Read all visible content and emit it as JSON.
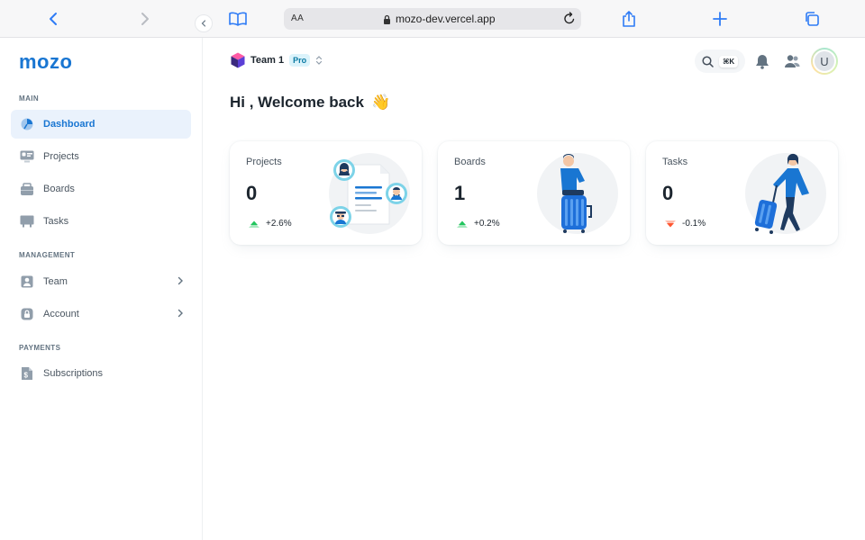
{
  "browser": {
    "text_size_label": "AA",
    "url": "mozo-dev.vercel.app"
  },
  "sidebar": {
    "logo": "mozo",
    "sections": {
      "main": "MAIN",
      "management": "MANAGEMENT",
      "payments": "PAYMENTS"
    },
    "items": [
      {
        "label": "Dashboard",
        "icon": "dashboard-icon",
        "active": true
      },
      {
        "label": "Projects",
        "icon": "projects-icon"
      },
      {
        "label": "Boards",
        "icon": "boards-icon"
      },
      {
        "label": "Tasks",
        "icon": "tasks-icon"
      },
      {
        "label": "Team",
        "icon": "team-icon",
        "has_children": true
      },
      {
        "label": "Account",
        "icon": "lock-icon",
        "has_children": true
      },
      {
        "label": "Subscriptions",
        "icon": "invoice-icon"
      }
    ]
  },
  "header": {
    "team_name": "Team 1",
    "plan_badge": "Pro",
    "search_shortcut": "⌘K",
    "avatar_initial": "U"
  },
  "main": {
    "greeting": "Hi , Welcome back",
    "greeting_emoji": "👋"
  },
  "cards": [
    {
      "title": "Projects",
      "value": "0",
      "trend": "+2.6%",
      "direction": "up"
    },
    {
      "title": "Boards",
      "value": "1",
      "trend": "+0.2%",
      "direction": "up"
    },
    {
      "title": "Tasks",
      "value": "0",
      "trend": "-0.1%",
      "direction": "down"
    }
  ],
  "colors": {
    "brand": "#1976d2",
    "trend_up": "#22c55e",
    "trend_down": "#ff5630",
    "active_nav_bg": "#eaf2fc"
  }
}
